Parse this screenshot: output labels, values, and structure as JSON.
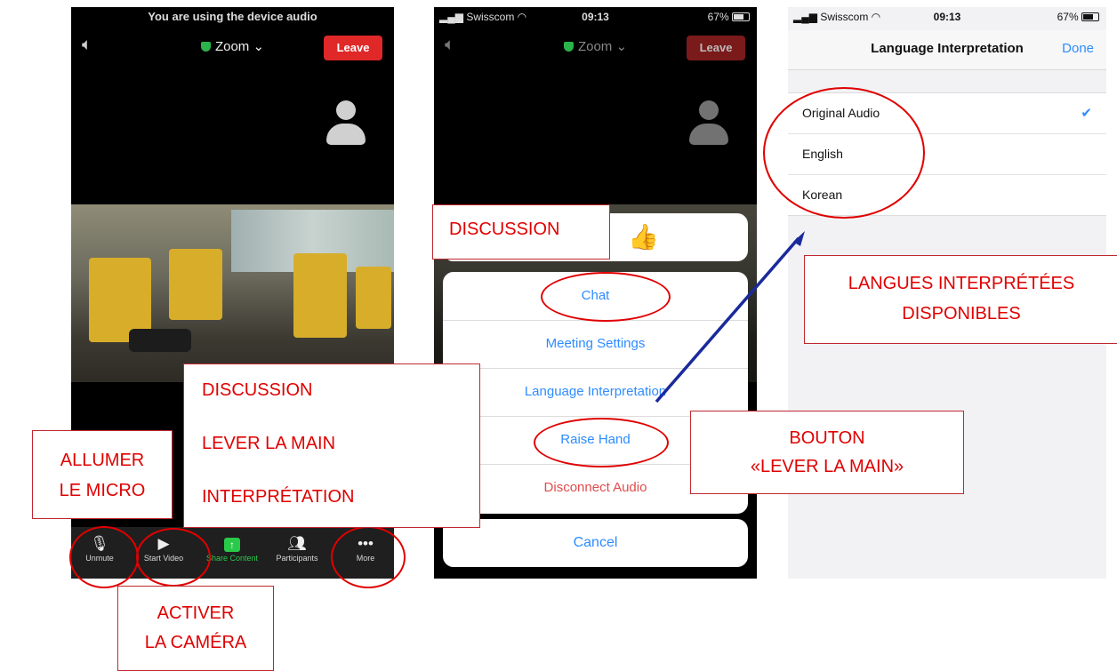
{
  "screen1": {
    "banner": "You are using the device audio",
    "title": "Zoom",
    "leave": "Leave",
    "toolbar": [
      {
        "icon": "microphone-muted-icon",
        "label": "Unmute"
      },
      {
        "icon": "video-off-icon",
        "label": "Start Video"
      },
      {
        "icon": "share-screen-icon",
        "label": "Share Content"
      },
      {
        "icon": "participants-icon",
        "label": "Participants"
      },
      {
        "icon": "more-dots-icon",
        "label": "More"
      }
    ]
  },
  "screen2": {
    "status": {
      "carrier": "Swisscom",
      "time": "09:13",
      "battery": "67%"
    },
    "title": "Zoom",
    "leave": "Leave",
    "reaction": "👍",
    "menu": [
      "Chat",
      "Meeting Settings",
      "Language Interpretation",
      "Raise Hand",
      "Disconnect Audio"
    ],
    "cancel": "Cancel"
  },
  "screen3": {
    "status": {
      "carrier": "Swisscom",
      "time": "09:13",
      "battery": "67%"
    },
    "title": "Language Interpretation",
    "done": "Done",
    "languages": [
      "Original Audio",
      "English",
      "Korean"
    ],
    "selected": "Original Audio"
  },
  "annotations": {
    "discussion_top": "DISCUSSION",
    "langues": [
      "LANGUES INTERPRÉTÉES",
      "DISPONIBLES"
    ],
    "features": [
      "DISCUSSION",
      "LEVER LA MAIN",
      "INTERPRÉTATION"
    ],
    "allumer": [
      "ALLUMER",
      "LE MICRO"
    ],
    "bouton": [
      "BOUTON",
      "«LEVER LA MAIN»"
    ],
    "activer": [
      "ACTIVER",
      "LA CAMÉRA"
    ]
  },
  "colors": {
    "accent": "#2d8cff",
    "danger": "#e02828",
    "annotation": "#e00000",
    "arrow": "#1a2a9c"
  }
}
